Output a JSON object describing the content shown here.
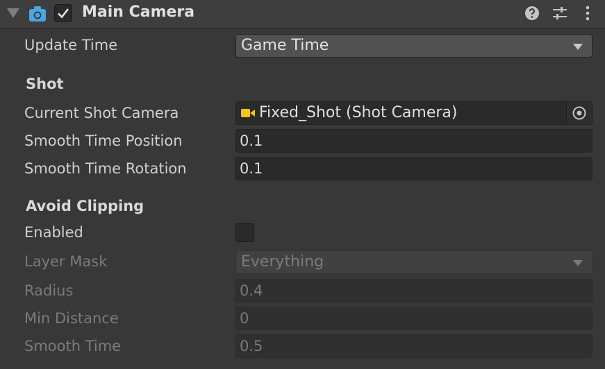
{
  "header": {
    "title": "Main Camera",
    "enabled": true,
    "icons": [
      "foldout-arrow",
      "camera-icon",
      "help-icon",
      "presets-icon",
      "more-menu-icon"
    ]
  },
  "fields": {
    "update_time": {
      "label": "Update Time",
      "value": "Game Time"
    },
    "shot_section": "Shot",
    "current_shot_camera": {
      "label": "Current Shot Camera",
      "value": "Fixed_Shot (Shot Camera)"
    },
    "smooth_time_position": {
      "label": "Smooth Time Position",
      "value": "0.1"
    },
    "smooth_time_rotation": {
      "label": "Smooth Time Rotation",
      "value": "0.1"
    },
    "avoid_clipping_section": "Avoid Clipping",
    "enabled": {
      "label": "Enabled",
      "checked": false
    },
    "layer_mask": {
      "label": "Layer Mask",
      "value": "Everything"
    },
    "radius": {
      "label": "Radius",
      "value": "0.4"
    },
    "min_distance": {
      "label": "Min Distance",
      "value": "0"
    },
    "smooth_time": {
      "label": "Smooth Time",
      "value": "0.5"
    }
  },
  "colors": {
    "background": "#383838",
    "header": "#3e3e3e",
    "camera_icon": "#4ba6e0",
    "shot_camera_icon": "#f5c518"
  }
}
